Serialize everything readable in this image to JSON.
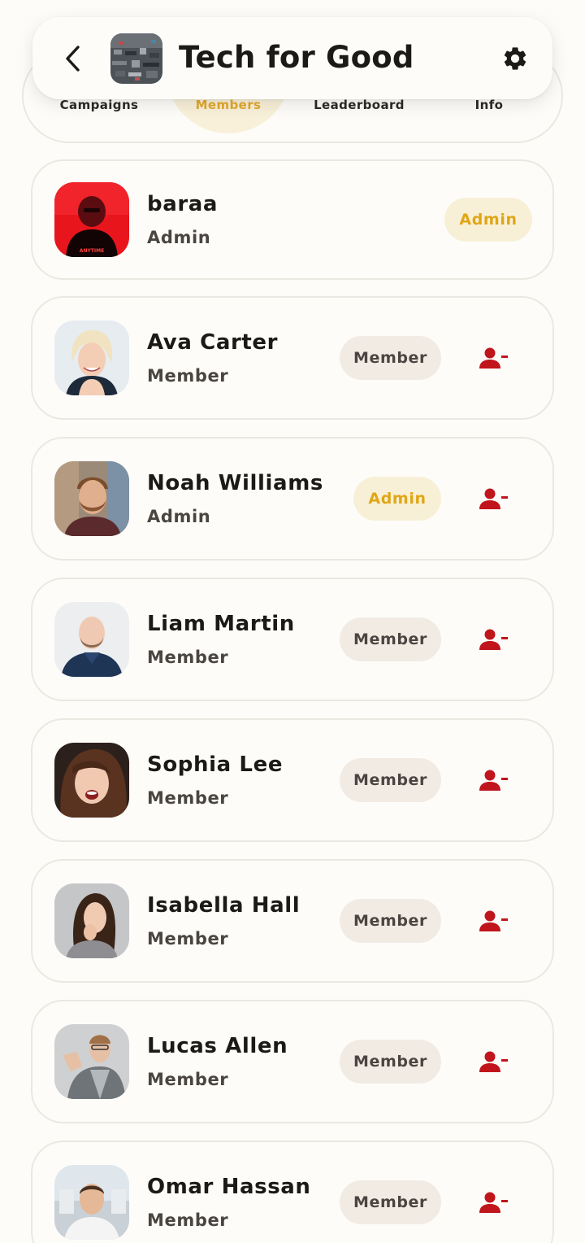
{
  "header": {
    "title": "Tech for Good",
    "back_icon": "chevron-left-icon",
    "settings_icon": "gear-icon"
  },
  "tabs": [
    {
      "label": "Campaigns",
      "active": false
    },
    {
      "label": "Members",
      "active": true
    },
    {
      "label": "Leaderboard",
      "active": false
    },
    {
      "label": "Info",
      "active": false
    }
  ],
  "colors": {
    "accent": "#e2a82a",
    "danger": "#c0151c",
    "background": "#fdfcf9"
  },
  "members": [
    {
      "name": "baraa",
      "role": "Admin",
      "badge": "Admin",
      "removable": false,
      "avatar": "red"
    },
    {
      "name": "Ava Carter",
      "role": "Member",
      "badge": "Member",
      "removable": true,
      "avatar": "blonde"
    },
    {
      "name": "Noah Williams",
      "role": "Admin",
      "badge": "Admin",
      "removable": true,
      "avatar": "beard"
    },
    {
      "name": "Liam Martin",
      "role": "Member",
      "badge": "Member",
      "removable": true,
      "avatar": "bald"
    },
    {
      "name": "Sophia Lee",
      "role": "Member",
      "badge": "Member",
      "removable": true,
      "avatar": "brunette"
    },
    {
      "name": "Isabella Hall",
      "role": "Member",
      "badge": "Member",
      "removable": true,
      "avatar": "surprised"
    },
    {
      "name": "Lucas Allen",
      "role": "Member",
      "badge": "Member",
      "removable": true,
      "avatar": "glasses"
    },
    {
      "name": "Omar Hassan",
      "role": "Member",
      "badge": "Member",
      "removable": true,
      "avatar": "street"
    }
  ]
}
